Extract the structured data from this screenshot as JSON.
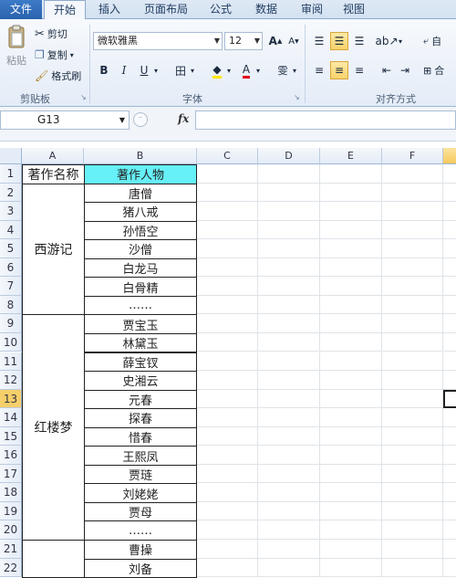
{
  "tabs": [
    "文件",
    "开始",
    "插入",
    "页面布局",
    "公式",
    "数据",
    "审阅",
    "视图"
  ],
  "clipboard": {
    "paste": "粘贴",
    "cut": "剪切",
    "copy": "复制",
    "format_painter": "格式刷",
    "label": "剪贴板"
  },
  "font": {
    "name": "微软雅黑",
    "size": "12",
    "grow": "A",
    "shrink": "A",
    "bold": "B",
    "italic": "I",
    "underline": "U",
    "border": "田",
    "fill": "A",
    "color": "A",
    "phonetic": "雯",
    "label": "字体"
  },
  "alignment": {
    "label": "对齐方式",
    "wrap": "自",
    "merge": "合"
  },
  "formula_bar": {
    "cell": "G13",
    "fx": "fx",
    "value": ""
  },
  "columns": [
    "A",
    "B",
    "C",
    "D",
    "E",
    "F"
  ],
  "rows": [
    "1",
    "2",
    "3",
    "4",
    "5",
    "6",
    "7",
    "8",
    "9",
    "10",
    "11",
    "12",
    "13",
    "14",
    "15",
    "16",
    "17",
    "18",
    "19",
    "20",
    "21",
    "22"
  ],
  "header": {
    "a": "著作名称",
    "b": "著作人物"
  },
  "groups": [
    {
      "name": "西游记",
      "people": [
        "唐僧",
        "猪八戒",
        "孙悟空",
        "沙僧",
        "白龙马",
        "白骨精",
        "……"
      ]
    },
    {
      "name": "红楼梦",
      "people": [
        "贾宝玉",
        "林黛玉",
        "薛宝钗",
        "史湘云",
        "元春",
        "探春",
        "惜春",
        "王熙凤",
        "贾琏",
        "刘姥姥",
        "贾母",
        "……"
      ]
    },
    {
      "name": "",
      "people": [
        "曹操",
        "刘备"
      ]
    }
  ],
  "selected_row": "13",
  "selected_col": "G",
  "colors": {
    "header_fill": "#66F0F7",
    "selection": "#F6CF6A"
  }
}
